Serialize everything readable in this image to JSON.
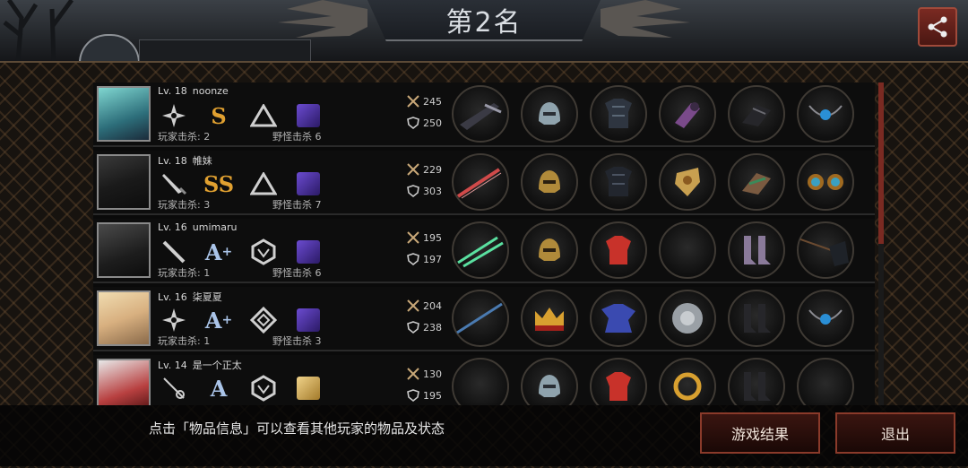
{
  "title": "第2名",
  "hint_text": "点击「物品信息」可以查看其他玩家的物品及状态",
  "buttons": {
    "results": "游戏结果",
    "exit": "退出"
  },
  "labels": {
    "player_kills": "玩家击杀: ",
    "monster_kills": "野怪击杀 "
  },
  "players": [
    {
      "level": "Lv. 18",
      "name": "noonze",
      "weapon_icon": "shuriken-icon",
      "grade": "S",
      "grade_plus": "",
      "player_kills": "2",
      "monster_kills": "6",
      "attack": "245",
      "defense": "250",
      "items": [
        "dark-blade-icon",
        "steel-helmet-icon",
        "black-armor-icon",
        "purple-gauntlet-icon",
        "black-gloves-icon",
        "blue-gem-necklace-icon"
      ]
    },
    {
      "level": "Lv. 18",
      "name": "帷妹",
      "weapon_icon": "dagger-icon",
      "grade": "SS",
      "grade_plus": "",
      "player_kills": "3",
      "monster_kills": "7",
      "attack": "229",
      "defense": "303",
      "items": [
        "red-sword-icon",
        "gold-helmet-icon",
        "dark-plate-armor-icon",
        "gold-badge-icon",
        "ornate-gauntlet-icon",
        "twin-gem-earrings-icon"
      ]
    },
    {
      "level": "Lv. 16",
      "name": "umimaru",
      "weapon_icon": "sword-icon",
      "grade": "A",
      "grade_plus": "+",
      "player_kills": "1",
      "monster_kills": "6",
      "attack": "195",
      "defense": "197",
      "items": [
        "green-twin-swords-icon",
        "gold-helmet-icon",
        "red-jacket-icon",
        "empty-slot",
        "purple-boots-icon",
        "dark-cloth-spear-icon"
      ]
    },
    {
      "level": "Lv. 16",
      "name": "柒夏夏",
      "weapon_icon": "shuriken-icon",
      "grade": "A",
      "grade_plus": "+",
      "player_kills": "1",
      "monster_kills": "3",
      "attack": "204",
      "defense": "238",
      "items": [
        "blue-lance-icon",
        "royal-crown-icon",
        "blue-robe-icon",
        "silver-disc-icon",
        "black-boots-icon",
        "blue-gem-necklace-icon"
      ]
    },
    {
      "level": "Lv. 14",
      "name": "是一个正太",
      "weapon_icon": "rapier-icon",
      "grade": "A",
      "grade_plus": "",
      "player_kills": "",
      "monster_kills": "",
      "attack": "130",
      "defense": "195",
      "items": [
        "empty-slot",
        "steel-helmet-icon",
        "red-jacket-icon",
        "gold-ring-icon",
        "black-boots-icon",
        "empty-slot"
      ]
    }
  ],
  "colors": {
    "accent_red": "#7a2a22",
    "grade_s": "#e0a030",
    "grade_a": "#aac4e8",
    "monster_purple": "#6b4bd1"
  }
}
